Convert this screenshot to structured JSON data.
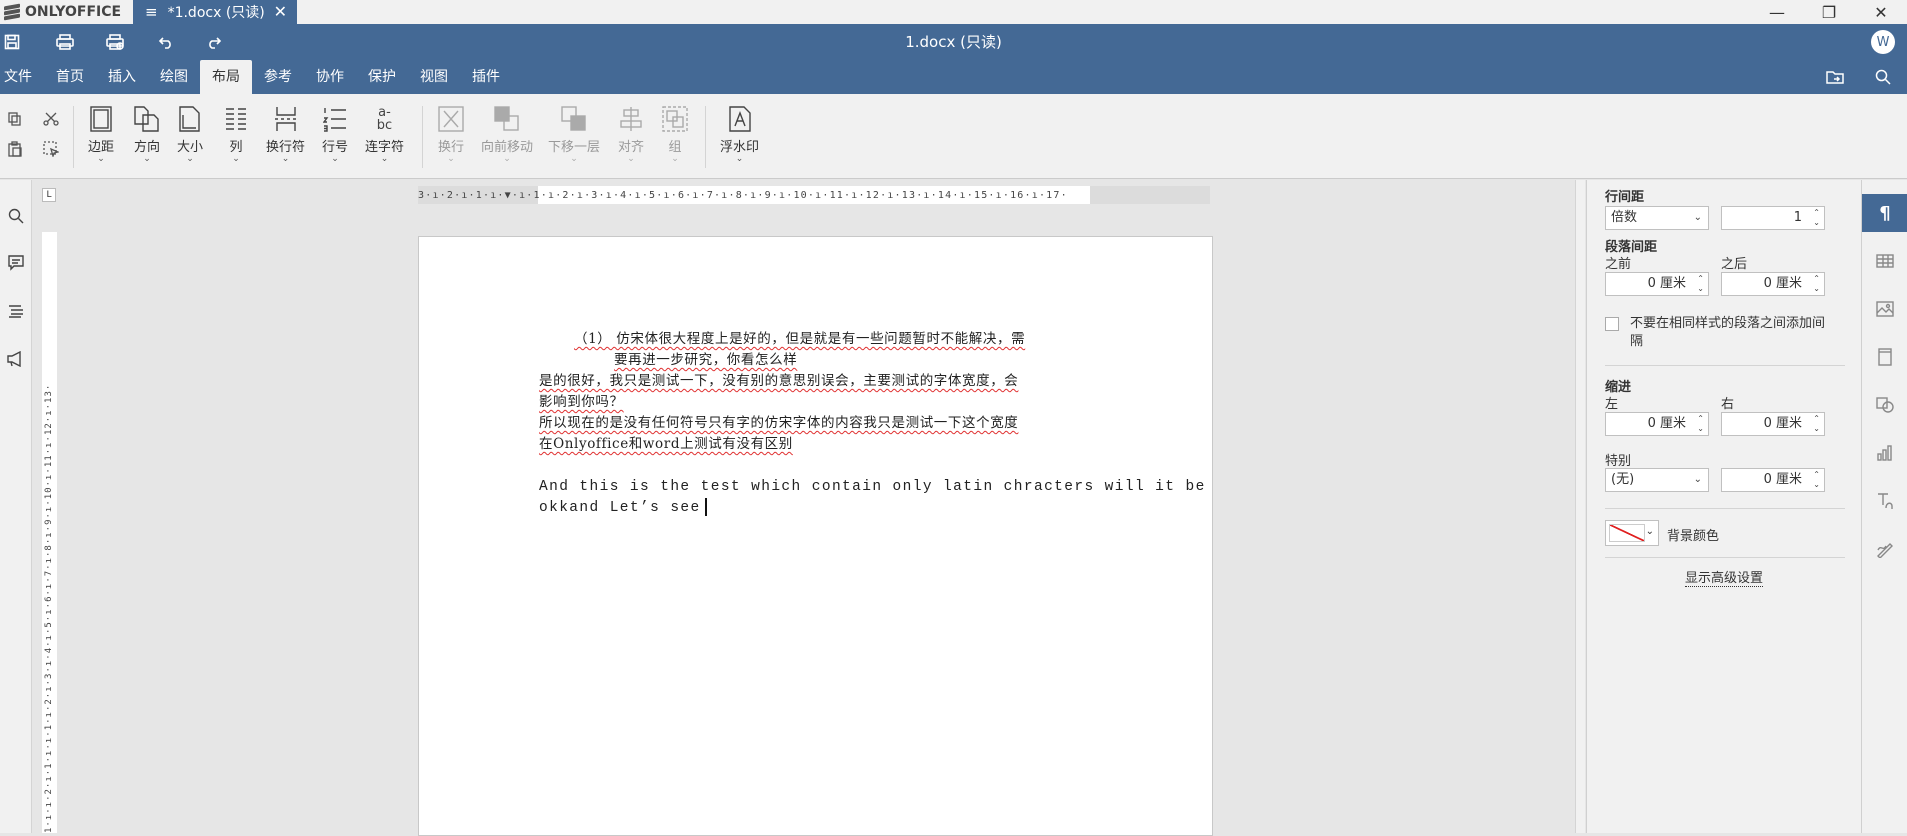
{
  "app": {
    "name": "ONLYOFFICE"
  },
  "tab": {
    "title": "*1.docx (只读)"
  },
  "window": {
    "minimize": "—",
    "maximize": "❐",
    "close": "✕"
  },
  "header": {
    "doc_title": "1.docx (只读)",
    "avatar_initial": "W"
  },
  "menu_tabs": [
    "文件",
    "首页",
    "插入",
    "绘图",
    "布局",
    "参考",
    "协作",
    "保护",
    "视图",
    "插件"
  ],
  "active_tab": "布局",
  "toolbar": {
    "margins": "边距",
    "orientation": "方向",
    "size": "大小",
    "columns": "列",
    "breaks": "换行符",
    "line_numbers": "行号",
    "hyphenation": "连字符",
    "wrapping": "换行",
    "bring_forward": "向前移动",
    "send_backward": "下移一层",
    "align": "对齐",
    "group": "组",
    "watermark": "浮水印",
    "hyphen_glyph_top": "a-",
    "hyphen_glyph_bottom": "bc"
  },
  "ruler": {
    "horizontal": "3·ı·2·ı·1·ı·▼·ı·1·ı·2·ı·3·ı·4·ı·5·ı·6·ı·7·ı·8·ı·9·ı·10·ı·11·ı·12·ı·13·ı·14·ı·15·ı·16·ı·17·",
    "vertical": "1·ı·ı·2·ı·1·ı·ı·1·ı·2·ı·3·ı·4·ı·5·ı·6·ı·7·ı·8·ı·9·ı·10·ı·11·ı·12·ı·13·",
    "corner": "L"
  },
  "document": {
    "para1_line1": "（1） 仿宋体很大程度上是好的，但是就是有一些问题暂时不能解决，需",
    "para1_line2": "要再进一步研究，你看怎么样",
    "para1_line3": "是的很好，我只是测试一下，没有别的意思别误会，主要测试的字体宽度，会",
    "para1_line4": "影响到你吗？",
    "para1_line5": "所以现在的是没有任何符号只有字的仿宋字体的内容我只是测试一下这个宽度",
    "para1_line6": "在Onlyoffice和word上测试有没有区别",
    "para2_line1": "And this is the test which contain only latin chracters will it be",
    "para2_line2": "okkand Let’s see"
  },
  "panel": {
    "line_spacing_label": "行间距",
    "line_spacing_mode": "倍数",
    "line_spacing_value": "1",
    "para_spacing_label": "段落间距",
    "before_label": "之前",
    "after_label": "之后",
    "before_value": "0 厘米",
    "after_value": "0 厘米",
    "no_space_same_style": "不要在相同样式的段落之间添加间",
    "no_space_same_style_2": "隔",
    "indent_label": "缩进",
    "left_label": "左",
    "right_label": "右",
    "left_value": "0 厘米",
    "right_value": "0 厘米",
    "special_label": "特别",
    "special_mode": "(无)",
    "special_value": "0 厘米",
    "bg_color_label": "背景颜色",
    "advanced_link": "显示高级设置"
  },
  "colors": {
    "accent": "#446995",
    "spell_error": "#e03030"
  }
}
